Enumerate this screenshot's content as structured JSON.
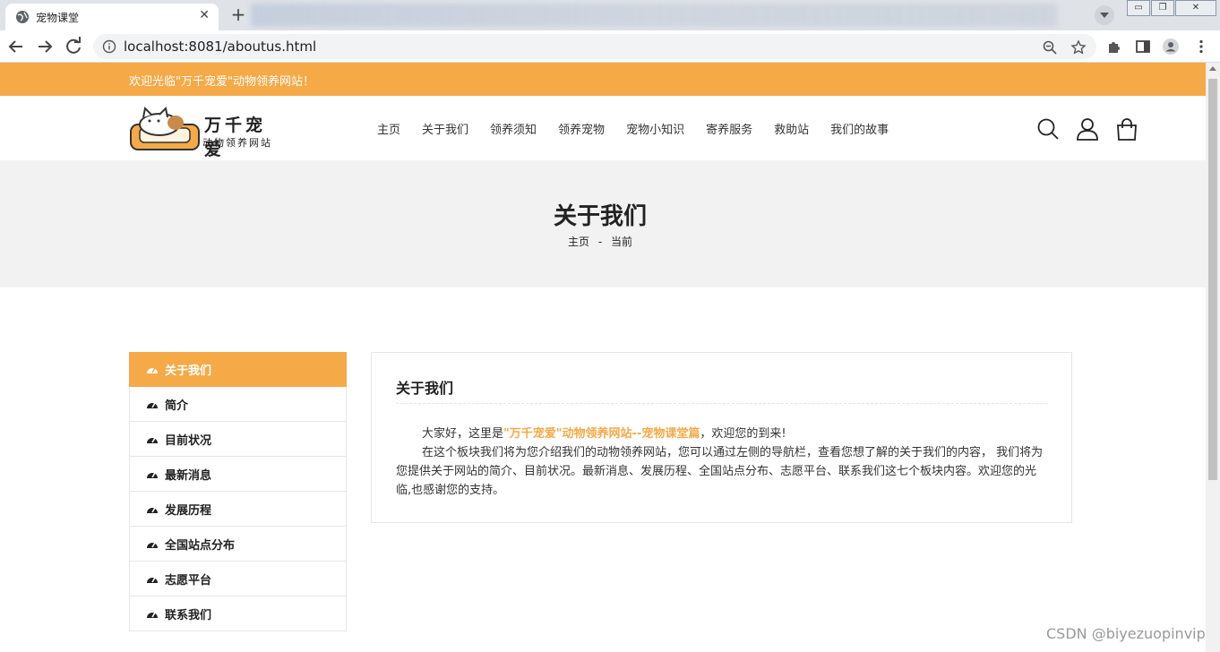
{
  "browser": {
    "tab_title": "宠物课堂",
    "new_tab": "+",
    "close_tab": "✕",
    "url_host": "localhost",
    "url_rest": ":8081/aboutus.html",
    "window_controls": {
      "minimize": "▭",
      "restore": "❐",
      "close": "✕"
    }
  },
  "topbar": {
    "welcome": "欢迎光临\"万千宠爱\"动物领养网站！",
    "color": "#f5a947"
  },
  "header": {
    "logo_title": "万千宠爱",
    "logo_subtitle": "动物领养网站",
    "menu": [
      "主页",
      "关于我们",
      "领养须知",
      "领养宠物",
      "宠物小知识",
      "寄养服务",
      "救助站",
      "我们的故事"
    ],
    "icons": [
      "search-icon",
      "user-icon",
      "shopping-bag-icon"
    ]
  },
  "banner": {
    "title": "关于我们",
    "crumb_home": "主页",
    "crumb_sep": "-",
    "crumb_current": "当前"
  },
  "sidebar": {
    "items": [
      {
        "label": "关于我们",
        "active": true
      },
      {
        "label": "简介",
        "active": false
      },
      {
        "label": "目前状况",
        "active": false
      },
      {
        "label": "最新消息",
        "active": false
      },
      {
        "label": "发展历程",
        "active": false
      },
      {
        "label": "全国站点分布",
        "active": false
      },
      {
        "label": "志愿平台",
        "active": false
      },
      {
        "label": "联系我们",
        "active": false
      }
    ]
  },
  "content": {
    "title": "关于我们",
    "p1_before": "大家好，这里是",
    "p1_highlight": "\"万千宠爱\"动物领养网站--宠物课堂篇",
    "p1_after": "，欢迎您的到来!",
    "p2": "在这个板块我们将为您介绍我们的动物领养网站，您可以通过左侧的导航栏，查看您想了解的关于我们的内容， 我们将为您提供关于网站的简介、目前状况。最新消息、发展历程、全国站点分布、志愿平台、联系我们这七个板块内容。欢迎您的光临,也感谢您的支持。"
  },
  "watermark": "CSDN @biyezuopinvip"
}
